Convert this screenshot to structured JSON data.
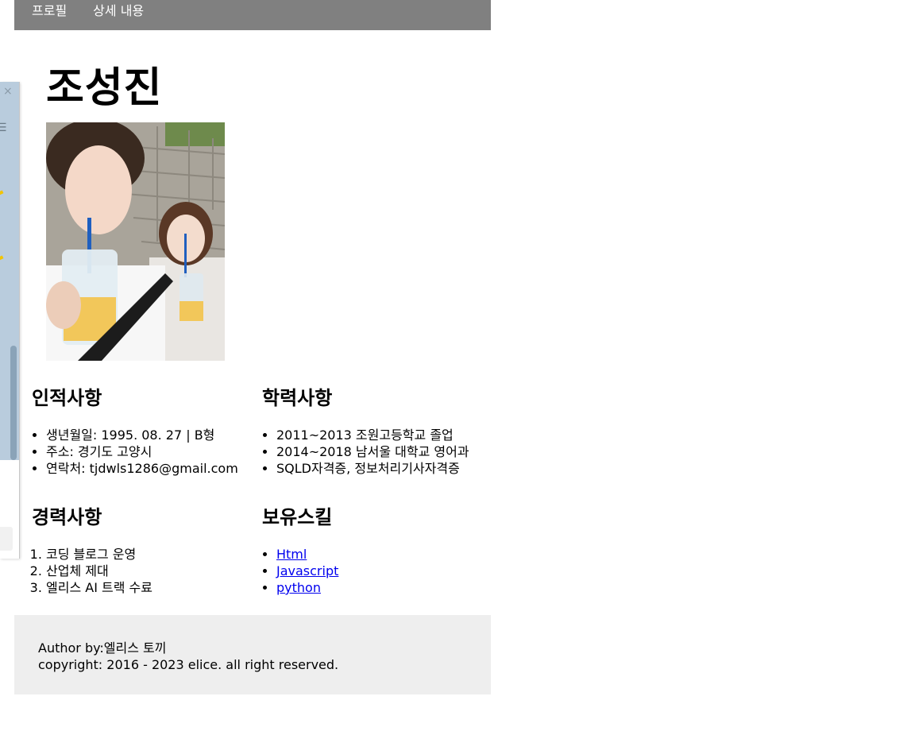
{
  "nav": {
    "profile": "프로필",
    "details": "상세 내용"
  },
  "header": {
    "name": "조성진"
  },
  "photo": {
    "icon": "profile-photo"
  },
  "personal": {
    "title": "인적사항",
    "items": [
      "생년월일: 1995. 08. 27 | B형",
      "주소: 경기도 고양시",
      "연락처: tjdwls1286@gmail.com"
    ]
  },
  "education": {
    "title": "학력사항",
    "items": [
      "2011~2013 조원고등학교 졸업",
      "2014~2018 남서울 대학교 영어과",
      "SQLD자격증, 정보처리기사자격증"
    ]
  },
  "career": {
    "title": "경력사항",
    "items": [
      "코딩 블로그 운영",
      "산업체 제대",
      "엘리스 AI 트랙 수료"
    ]
  },
  "skills": {
    "title": "보유스킬",
    "items": [
      "Html",
      "Javascript",
      "python"
    ]
  },
  "footer": {
    "author": "Author by:엘리스 토끼",
    "copyright": "copyright: 2016 - 2023 elice. all right reserved."
  },
  "side_panel": {
    "close_icon": "×",
    "menu_icon": "☰"
  },
  "colors": {
    "nav_bg": "#808080",
    "footer_bg": "#eeeeee",
    "link": "#0000ee"
  }
}
